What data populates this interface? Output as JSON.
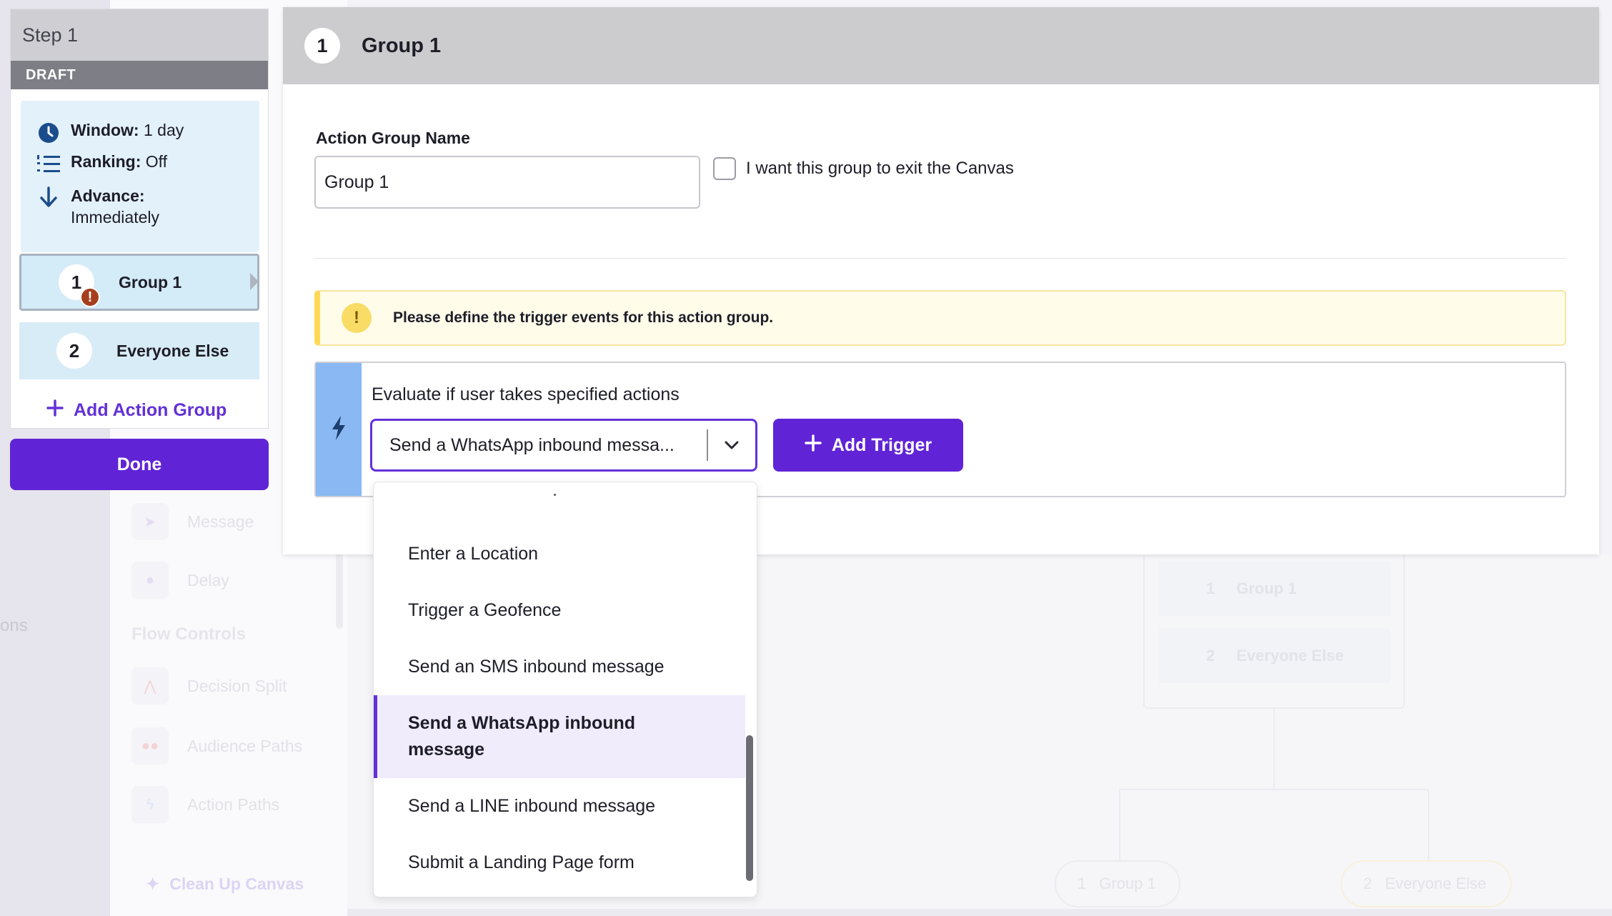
{
  "background": {
    "faded_left_word": "ons",
    "sidebar_items": [
      {
        "label": "Message",
        "icon": "send-icon"
      },
      {
        "label": "Delay",
        "icon": "clock-icon"
      }
    ],
    "flow_controls_title": "Flow Controls",
    "flow_items": [
      {
        "label": "Decision Split",
        "icon": "split-icon"
      },
      {
        "label": "Audience Paths",
        "icon": "people-icon"
      },
      {
        "label": "Action Paths",
        "icon": "bolt-icon"
      }
    ],
    "cleanup_label": "Clean Up Canvas",
    "canvas_groups": [
      {
        "num": "1",
        "label": "Group 1"
      },
      {
        "num": "2",
        "label": "Everyone Else"
      }
    ],
    "canvas_pills": [
      {
        "num": "1",
        "label": "Group 1"
      },
      {
        "num": "2",
        "label": "Everyone Else"
      }
    ]
  },
  "step_panel": {
    "title": "Step 1",
    "status": "DRAFT",
    "window_label": "Window:",
    "window_value": "1 day",
    "ranking_label": "Ranking:",
    "ranking_value": "Off",
    "advance_label": "Advance:",
    "advance_value": "Immediately",
    "groups": [
      {
        "num": "1",
        "label": "Group 1",
        "warning": "!"
      },
      {
        "num": "2",
        "label": "Everyone Else"
      }
    ],
    "add_action_group": "Add Action Group",
    "done": "Done"
  },
  "group_panel": {
    "num": "1",
    "title": "Group 1",
    "name_label": "Action Group Name",
    "name_value": "Group 1",
    "exit_label": "I want this group to exit the Canvas",
    "alert_icon": "!",
    "alert_text": "Please define the trigger events for this action group.",
    "trigger_title": "Evaluate if user takes specified actions",
    "trigger_selected": "Send a WhatsApp inbound messa...",
    "add_trigger": "Add Trigger"
  },
  "dropdown": {
    "options": [
      "Enter a Location",
      "Trigger a Geofence",
      "Send an SMS inbound message",
      "Send a WhatsApp inbound message",
      "Send a LINE inbound message",
      "Submit a Landing Page form"
    ],
    "selected_index": 3
  },
  "colors": {
    "accent": "#6024d6",
    "info_bg": "#e3f1fa",
    "warning": "#ffd955",
    "trigger_strip": "#89b8f2"
  }
}
